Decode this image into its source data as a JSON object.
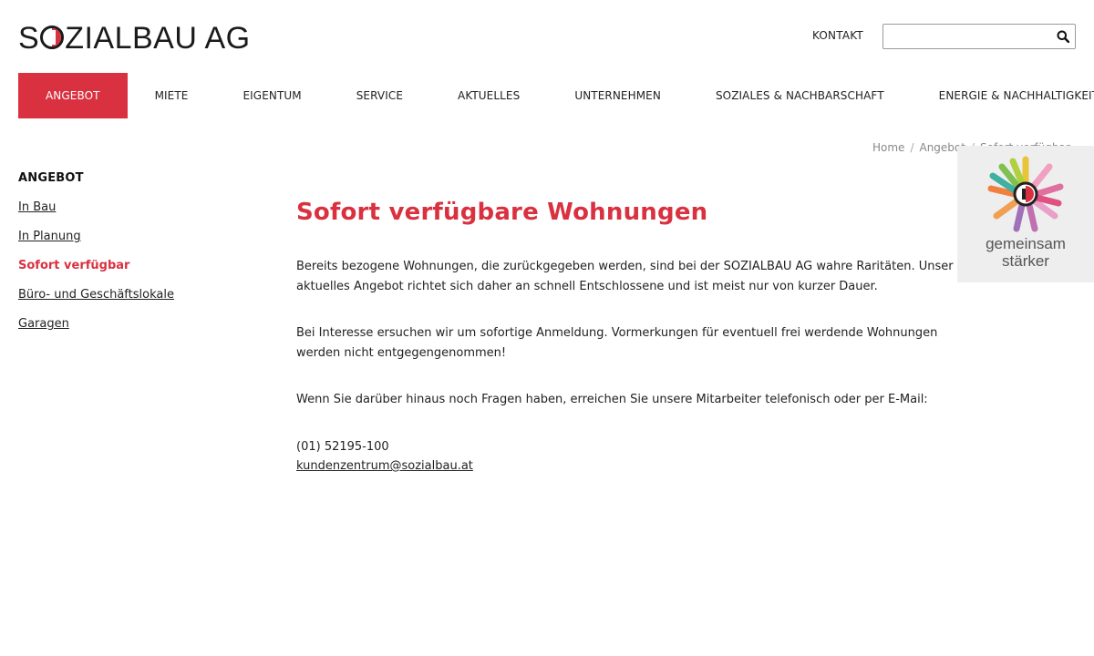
{
  "header": {
    "logo_left": "S",
    "logo_right": "ZIALBAU AG",
    "kontakt_label": "KONTAKT",
    "search_placeholder": ""
  },
  "nav": [
    {
      "label": "ANGEBOT",
      "active": true
    },
    {
      "label": "MIETE"
    },
    {
      "label": "EIGENTUM"
    },
    {
      "label": "SERVICE"
    },
    {
      "label": "AKTUELLES"
    },
    {
      "label": "UNTERNEHMEN"
    },
    {
      "label": "SOZIALES & NACHBARSCHAFT"
    },
    {
      "label": "ENERGIE & NACHHALTIGKEIT"
    }
  ],
  "breadcrumb": {
    "home": "Home",
    "sep": "/",
    "parent": "Angebot",
    "current": "Sofort verfügbar"
  },
  "sidebar": {
    "title": "ANGEBOT",
    "items": [
      {
        "label": "In Bau"
      },
      {
        "label": "In Planung"
      },
      {
        "label": "Sofort verfügbar",
        "current": true
      },
      {
        "label": "Büro- und Geschäftslokale"
      },
      {
        "label": "Garagen"
      }
    ]
  },
  "main": {
    "title": "Sofort verfügbare Wohnungen",
    "paragraphs": [
      "Bereits bezogene Wohnungen, die zurückgegeben werden, sind bei der SOZIALBAU AG wahre Raritäten. Unser aktuelles Angebot richtet sich daher an schnell Entschlossene und ist meist nur von kurzer Dauer.",
      "Bei Interesse ersuchen wir um sofortige Anmeldung. Vormerkungen für eventuell frei werdende Wohnungen werden nicht entgegengenommen!",
      "Wenn Sie darüber hinaus noch Fragen haben, erreichen Sie unsere Mitarbeiter telefonisch oder per E-Mail:"
    ],
    "phone": "(01) 52195-100",
    "email": "kundenzentrum@sozialbau.at"
  },
  "badge": {
    "line1": "gemeinsam",
    "line2": "stärker"
  },
  "colors": {
    "accent": "#d9313f",
    "badge_bg": "#eeeeee"
  }
}
